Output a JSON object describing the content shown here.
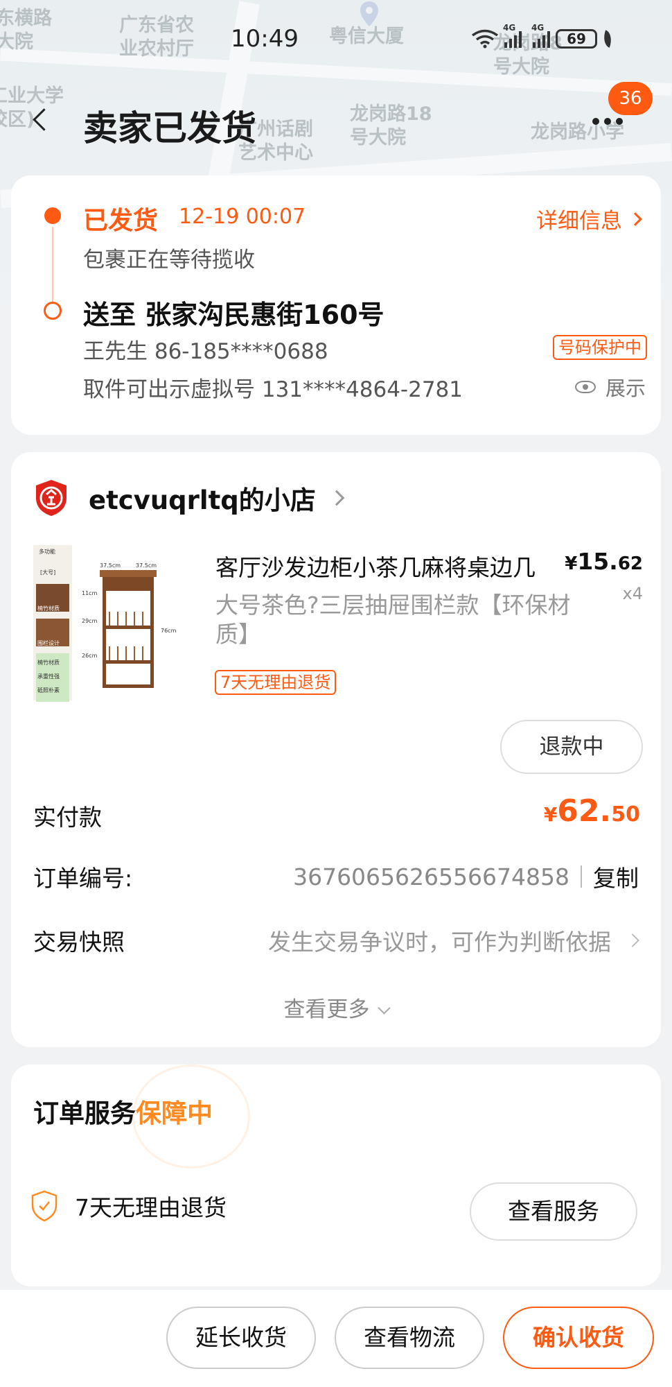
{
  "map": {
    "labels": [
      "东横路\n大院",
      "广东省农\n业农村厅",
      "粤信大厦",
      "龙岗路8\n号大院",
      "工业大学\n校区)",
      "广州话剧\n艺术中心",
      "龙岗路18\n号大院",
      "龙岗路小学"
    ]
  },
  "status_bar": {
    "time": "10:49",
    "net1": "4G",
    "net2": "4G",
    "battery": "69"
  },
  "header": {
    "title": "卖家已发货",
    "badge": "36"
  },
  "logistics": {
    "status": "已发货",
    "time": "12-19 00:07",
    "detail_link": "详细信息",
    "sub_status": "包裹正在等待揽收",
    "address": "送至 张家沟民惠街160号",
    "contact": "王先生 86-185****0688",
    "protect_tag": "号码保护中",
    "pickup_hint": "取件可出示虚拟号 131****4864-2781",
    "show_label": "展示"
  },
  "order": {
    "shop_name": "etcvuqrltq的小店",
    "product": {
      "title": "客厅沙发边柜小茶几麻将桌边几",
      "price_currency": "¥",
      "price_int": "15.",
      "price_dec": "62",
      "qty": "x4",
      "spec": "大号茶色?三层抽屉围栏款【环保材质】",
      "return_tag": "7天无理由退货",
      "img_labels": [
        "多功能",
        "[大号]",
        "楠竹材质",
        "围栏设计",
        "楠竹材质",
        "承重性强",
        "砥照朴素",
        "37.5cm",
        "37.5cm",
        "11cm",
        "29cm",
        "26cm",
        "76cm"
      ]
    },
    "refund_button": "退款中",
    "paid_label": "实付款",
    "paid_currency": "¥",
    "paid_int": "62.",
    "paid_dec": "50",
    "order_no_label": "订单编号:",
    "order_no": "3676065626556674858",
    "copy_label": "复制",
    "snapshot_label": "交易快照",
    "snapshot_value": "发生交易争议时，可作为判断依据",
    "see_more": "查看更多"
  },
  "service": {
    "title_a": "订单服务",
    "title_b": "保障中",
    "item_name": "7天无理由退货",
    "view_button": "查看服务"
  },
  "bottom_bar": {
    "extend": "延长收货",
    "track": "查看物流",
    "confirm": "确认收货"
  },
  "colors": {
    "accent": "#ff5a12",
    "service_highlight": "#ff8a1f"
  }
}
